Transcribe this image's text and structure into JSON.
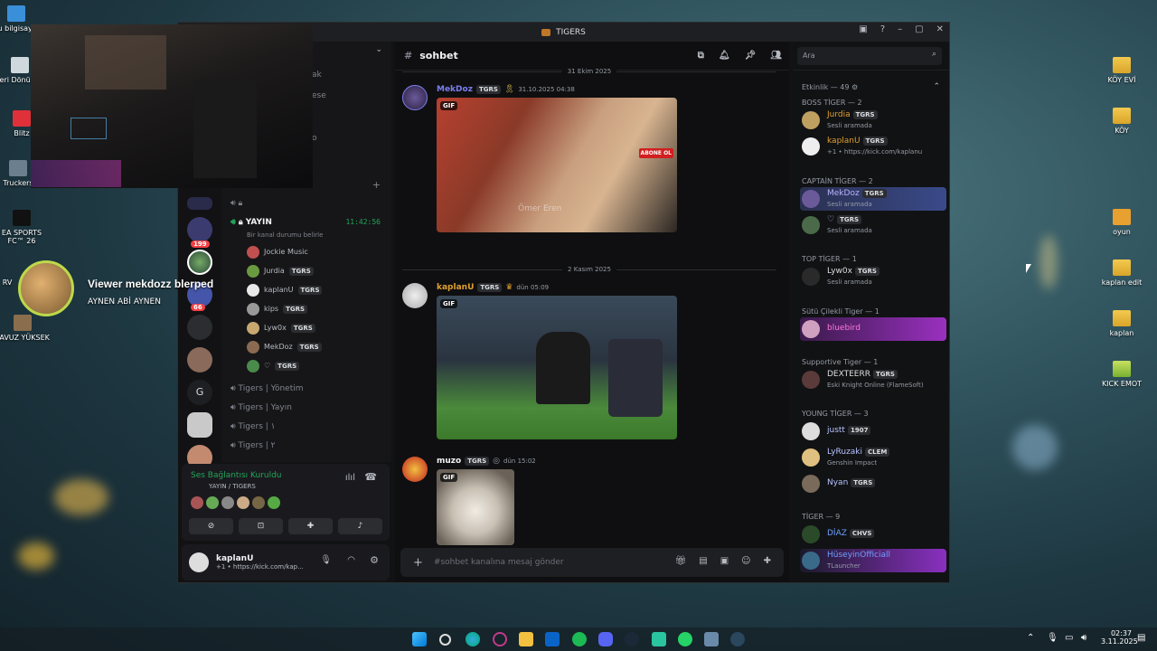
{
  "desktop": {
    "left_icons": [
      "Bu bilgisayar",
      "Geri Dönüşüm",
      "Blitz",
      "Truckers",
      "EA SPORTS FC™ 26",
      "RV",
      "YAVUZ YÜKSEK"
    ],
    "right_icons": [
      "KÖY EVİ",
      "KÖY",
      "oyun",
      "kaplan edit",
      "kaplan",
      "KICK EMOT"
    ]
  },
  "viewer_alert": {
    "line1": "Viewer mekdozz blerped",
    "line2": "AYNEN ABİ AYNEN"
  },
  "window": {
    "title": "TIGERS"
  },
  "channels": {
    "header_frag": "ak",
    "frag2": "ese",
    "frag3": "o",
    "live_channel": "YAYIN",
    "live_time": "11:42:56",
    "status_hint": "Bir kanal durumu belirle",
    "voice_users": [
      {
        "name": "Jockie Music",
        "tag": ""
      },
      {
        "name": "Jurdia",
        "tag": "TGRS"
      },
      {
        "name": "kaplanU",
        "tag": "TGRS"
      },
      {
        "name": "kips",
        "tag": "TGRS"
      },
      {
        "name": "Lyw0x",
        "tag": "TGRS"
      },
      {
        "name": "MekDoz",
        "tag": "TGRS"
      },
      {
        "name": "♡",
        "tag": "TGRS"
      }
    ],
    "others": [
      "Tigers | Yönetim",
      "Tigers | Yayın",
      "Tigers | ۱",
      "Tigers | ۲"
    ]
  },
  "rail": {
    "badge1": "199",
    "badge2": "66",
    "letter": "G"
  },
  "voice_panel": {
    "status": "Ses Bağlantısı Kuruldu",
    "location": "YAYIN / TIGERS"
  },
  "user_panel": {
    "name": "kaplanU",
    "status": "+1 • https://kick.com/kap..."
  },
  "chat": {
    "channel": "sohbet",
    "date_top": "31 Ekim 2025",
    "date_mid": "2 Kasım 2025",
    "messages": [
      {
        "author": "MekDoz",
        "tag": "TGRS",
        "time": "31.10.2025 04:38",
        "author_color": "#7b7ff0"
      },
      {
        "author": "kaplanU",
        "tag": "TGRS",
        "time": "dün 05:09",
        "author_color": "#e0a030"
      },
      {
        "author": "muzo",
        "tag": "TGRS",
        "time": "dün 15:02",
        "author_color": "#f2f3f5"
      }
    ],
    "gif_label": "GIF",
    "gif_watermark": "Ömer Eren",
    "gif_sign": "ABONE OL",
    "composer_placeholder": "#sohbet kanalına mesaj gönder"
  },
  "members": {
    "search_placeholder": "Ara",
    "activity": "Etkinlik — 49",
    "groups": [
      {
        "label": "BOSS TİGER — 2"
      },
      {
        "label": "CAPTAİN TİGER — 2"
      },
      {
        "label": "TOP TİGER — 1"
      },
      {
        "label": "Sütü Çilekli Tiger — 1"
      },
      {
        "label": "Supportive Tiger — 1"
      },
      {
        "label": "YOUNG TİGER — 3"
      },
      {
        "label": "TİGER — 9"
      }
    ],
    "list": [
      {
        "name": "Jurdia",
        "tag": "TGRS",
        "status": "Sesli aramada",
        "color": "#e0a030"
      },
      {
        "name": "kaplanU",
        "tag": "TGRS",
        "status": "+1 • https://kick.com/kaplanu",
        "color": "#e0a030"
      },
      {
        "name": "MekDoz",
        "tag": "TGRS",
        "status": "Sesli aramada",
        "color": "#b8b4ff"
      },
      {
        "name": "♡",
        "tag": "TGRS",
        "status": "Sesli aramada",
        "color": "#b8b4ff"
      },
      {
        "name": "Lyw0x",
        "tag": "TGRS",
        "status": "Sesli aramada",
        "color": "#dbdee1"
      },
      {
        "name": "bluebird",
        "tag": "",
        "status": "",
        "color": "#ff7ad9"
      },
      {
        "name": "DEXTEERR",
        "tag": "TGRS",
        "status": "Eski Knight Online (FlameSoft)",
        "color": "#dbdee1"
      },
      {
        "name": "justt",
        "tag": "1907",
        "status": "",
        "color": "#b8c4ff"
      },
      {
        "name": "LyRuzaki",
        "tag": "CLEM",
        "status": "Genshin Impact",
        "color": "#b8c4ff"
      },
      {
        "name": "Nyan",
        "tag": "TGRS",
        "status": "",
        "color": "#b8c4ff"
      },
      {
        "name": "DİAZ",
        "tag": "CHVS",
        "status": "",
        "color": "#6ea0ff"
      },
      {
        "name": "HüseyinOfficiall",
        "tag": "",
        "status": "TLauncher",
        "color": "#6ea0ff"
      }
    ]
  },
  "taskbar": {
    "time": "02:37",
    "date": "3.11.2025"
  },
  "colors": {
    "accent": "#5865f2",
    "online": "#23a55a",
    "dnd": "#f23f43"
  }
}
